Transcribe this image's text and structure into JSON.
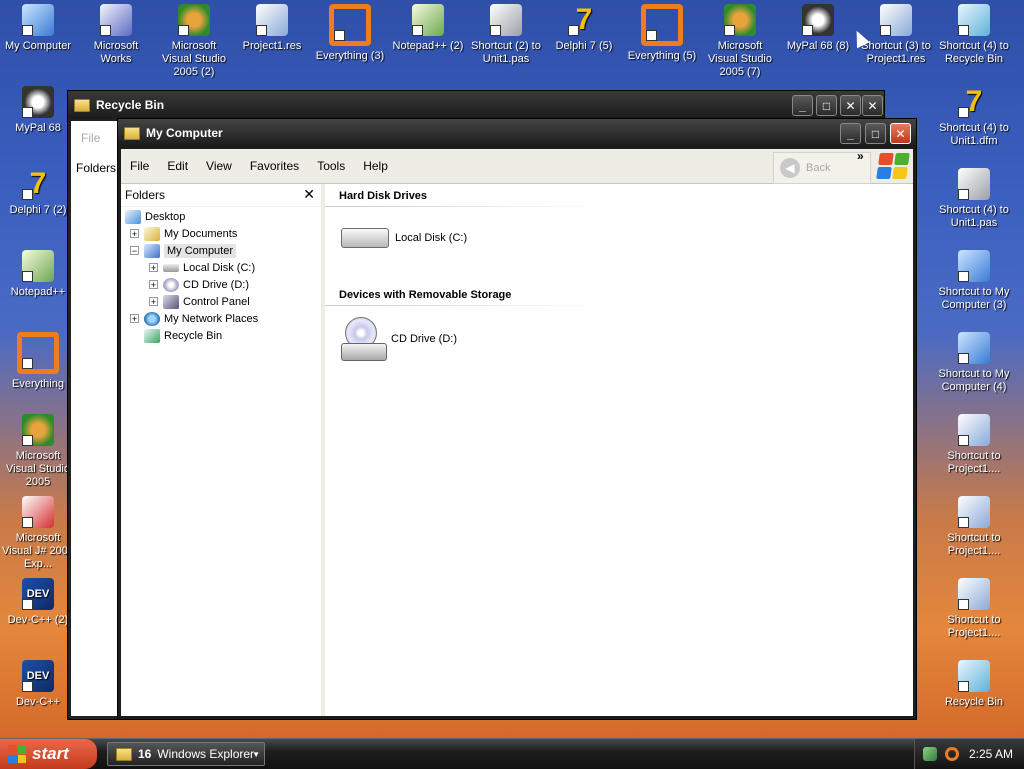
{
  "desktop": {
    "icons_top": [
      {
        "label": "My Computer",
        "icon": "computer-icon"
      },
      {
        "label": "Microsoft Works",
        "icon": "works-icon"
      },
      {
        "label": "Microsoft Visual Studio 2005 (2)",
        "icon": "visual-studio-icon"
      },
      {
        "label": "Project1.res",
        "icon": "res-file-icon"
      },
      {
        "label": "Everything (3)",
        "icon": "everything-icon"
      },
      {
        "label": "Notepad++ (2)",
        "icon": "notepadpp-icon"
      },
      {
        "label": "Shortcut (2) to Unit1.pas",
        "icon": "pas-file-icon"
      },
      {
        "label": "Delphi 7 (5)",
        "icon": "delphi-icon"
      },
      {
        "label": "Everything (5)",
        "icon": "everything-icon"
      },
      {
        "label": "Microsoft Visual Studio 2005 (7)",
        "icon": "visual-studio-icon"
      },
      {
        "label": "MyPal 68 (8)",
        "icon": "mypal-icon"
      },
      {
        "label": "Shortcut (3) to Project1.res",
        "icon": "res-file-icon"
      },
      {
        "label": "Shortcut (4) to Recycle Bin",
        "icon": "recycle-bin-icon"
      }
    ],
    "icons_left": [
      {
        "label": "MyPal 68",
        "icon": "mypal-icon"
      },
      {
        "label": "Delphi 7 (2)",
        "icon": "delphi-icon"
      },
      {
        "label": "Notepad++",
        "icon": "notepadpp-icon"
      },
      {
        "label": "Everything",
        "icon": "everything-icon"
      },
      {
        "label": "Microsoft Visual Studio 2005",
        "icon": "visual-studio-icon"
      },
      {
        "label": "Microsoft Visual J# 2005 Exp...",
        "icon": "vj-icon"
      },
      {
        "label": "Dev-C++ (2)",
        "icon": "devcpp-icon"
      },
      {
        "label": "Dev-C++",
        "icon": "devcpp-icon"
      }
    ],
    "icons_right": [
      {
        "label": "Shortcut (4) to Unit1.dfm",
        "icon": "delphi-icon"
      },
      {
        "label": "Shortcut (4) to Unit1.pas",
        "icon": "pas-file-icon"
      },
      {
        "label": "Shortcut to My Computer (3)",
        "icon": "computer-icon"
      },
      {
        "label": "Shortcut to My Computer (4)",
        "icon": "computer-icon"
      },
      {
        "label": "Shortcut to Project1....",
        "icon": "project-file-icon"
      },
      {
        "label": "Shortcut to Project1....",
        "icon": "project-file-icon"
      },
      {
        "label": "Shortcut to Project1....",
        "icon": "project-file-icon"
      },
      {
        "label": "Recycle Bin",
        "icon": "recycle-bin-icon"
      }
    ]
  },
  "background_window": {
    "title": "Recycle Bin",
    "menu_file": "File",
    "folders_label": "Folders"
  },
  "window": {
    "title": "My Computer",
    "controls": {
      "minimize": "_",
      "maximize": "□",
      "close": "✕"
    },
    "menu": [
      "File",
      "Edit",
      "View",
      "Favorites",
      "Tools",
      "Help"
    ],
    "back_label": "Back",
    "chevron": "»"
  },
  "folders_pane": {
    "title": "Folders",
    "close": "✕",
    "tree": [
      {
        "label": "Desktop",
        "icon": "desktop-icon",
        "expander": ""
      },
      {
        "label": "My Documents",
        "icon": "my-documents-icon",
        "expander": "+"
      },
      {
        "label": "My Computer",
        "icon": "my-computer-icon",
        "expander": "−"
      },
      {
        "label": "Local Disk (C:)",
        "icon": "hard-disk-icon",
        "expander": "+"
      },
      {
        "label": "CD Drive (D:)",
        "icon": "cd-drive-icon",
        "expander": "+"
      },
      {
        "label": "Control Panel",
        "icon": "control-panel-icon",
        "expander": "+"
      },
      {
        "label": "My Network Places",
        "icon": "network-places-icon",
        "expander": "+"
      },
      {
        "label": "Recycle Bin",
        "icon": "recycle-bin-icon",
        "expander": ""
      }
    ]
  },
  "content": {
    "section_hdd": "Hard Disk Drives",
    "drive_c": "Local Disk (C:)",
    "section_removable": "Devices with Removable Storage",
    "drive_d": "CD Drive (D:)"
  },
  "taskbar": {
    "start_label": "start",
    "task_count": "16",
    "task_label": "Windows Explorer",
    "clock": "2:25 AM"
  }
}
